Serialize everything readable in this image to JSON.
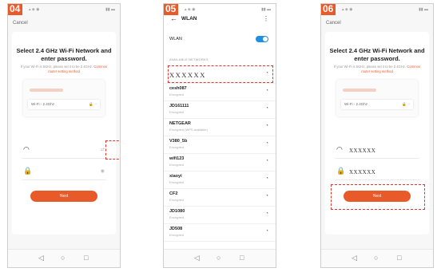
{
  "steps": [
    {
      "badge": "04",
      "cancel": "Cancel",
      "title": "Select 2.4 GHz Wi-Fi Network and enter password.",
      "subtitle": "If your Wi-Fi is 5GHz, please set it to be 2.4GHz.",
      "subtitle_link": "Common router setting method",
      "wifi_label": "Wi-Fi - 2.4Ghz",
      "ssid_value": "",
      "password_value": "",
      "next_label": "Next"
    },
    {
      "badge": "05",
      "header_title": "WLAN",
      "wlan_label": "WLAN",
      "wlan_on": true,
      "available_label": "AVAILABLE NETWORKS",
      "networks": [
        {
          "name": "XXXXXX",
          "status": ""
        },
        {
          "name": "cesh087",
          "status": "Encrypted"
        },
        {
          "name": "JD161111",
          "status": "Encrypted"
        },
        {
          "name": "NETGEAR",
          "status": "Encrypted (WPS available)"
        },
        {
          "name": "V380_5b",
          "status": "Encrypted"
        },
        {
          "name": "wifi123",
          "status": "Encrypted"
        },
        {
          "name": "xiaoyi",
          "status": "Encrypted"
        },
        {
          "name": "CF2",
          "status": "Encrypted"
        },
        {
          "name": "JD1080",
          "status": "Encrypted"
        },
        {
          "name": "JD508",
          "status": "Encrypted"
        }
      ]
    },
    {
      "badge": "06",
      "cancel": "Cancel",
      "title": "Select 2.4 GHz Wi-Fi Network and enter password.",
      "subtitle": "If your Wi-Fi is 5GHz, please set it to be 2.4GHz.",
      "subtitle_link": "Common router setting method",
      "wifi_label": "Wi-Fi - 2.4Ghz",
      "ssid_value": "XXXXXX",
      "password_value": "XXXXXX",
      "next_label": "Next"
    }
  ],
  "colors": {
    "accent": "#e95a2b",
    "highlight": "#e5342b",
    "toggle": "#1e8fe3"
  }
}
